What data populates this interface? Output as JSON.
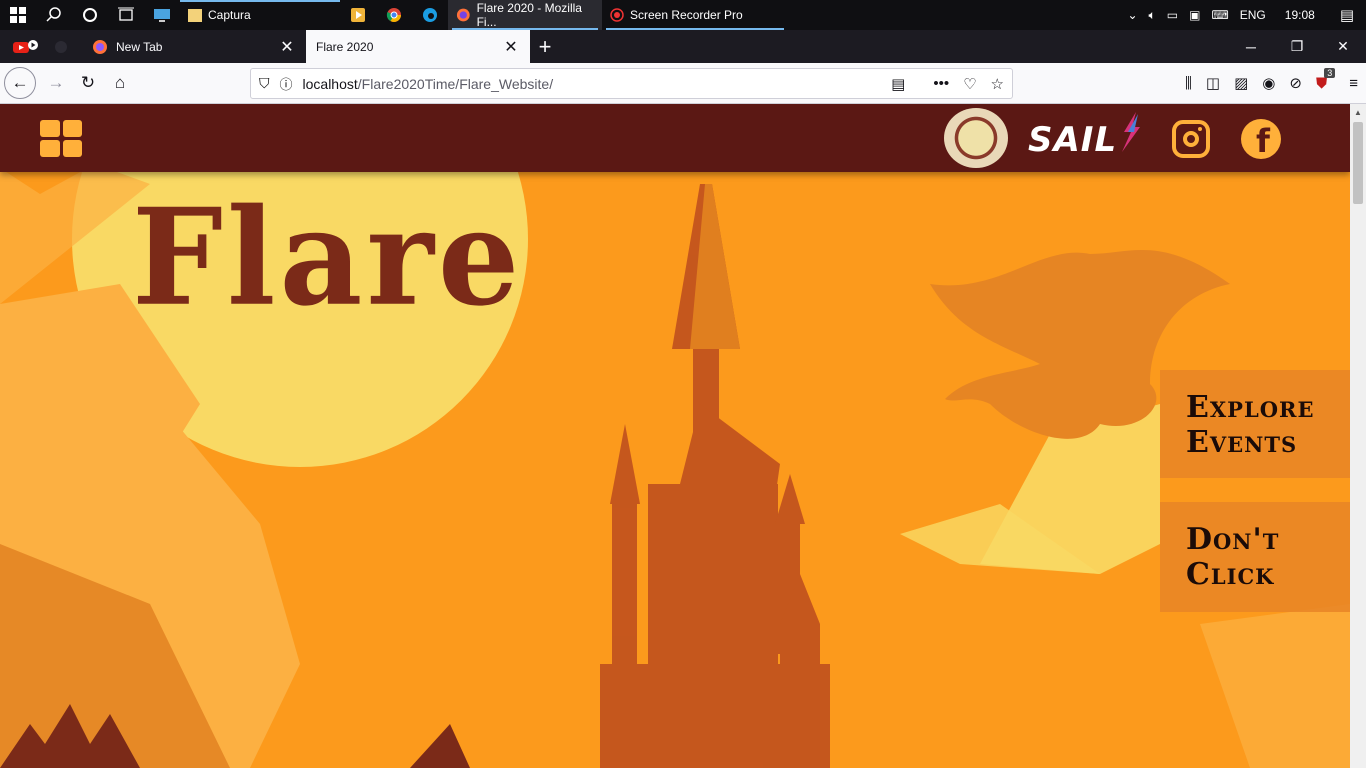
{
  "taskbar": {
    "apps": [
      {
        "name": "Captura",
        "label": "Captura"
      },
      {
        "name": "Firefox window",
        "label": "Flare 2020 - Mozilla Fi..."
      },
      {
        "name": "Screen Recorder",
        "label": "Screen Recorder Pro"
      }
    ],
    "language": "ENG",
    "time": "19:08"
  },
  "browser": {
    "tabs": [
      {
        "title": "New Tab"
      },
      {
        "title": "Flare 2020"
      }
    ],
    "url_host": "localhost",
    "url_path": "/Flare2020Time/Flare_Website/",
    "notification_count": "3"
  },
  "site": {
    "logo_text": "Flare",
    "sponsor_text": "SAIL",
    "buttons": {
      "explore_line1": "Explore",
      "explore_line2": "Events",
      "dont_line1": "Don't",
      "dont_line2": "Click"
    },
    "colors": {
      "header": "#5b1814",
      "background": "#fc9a1c",
      "accent": "#ffb03a",
      "moon": "#f9d964",
      "castle": "#7b2a18"
    }
  }
}
